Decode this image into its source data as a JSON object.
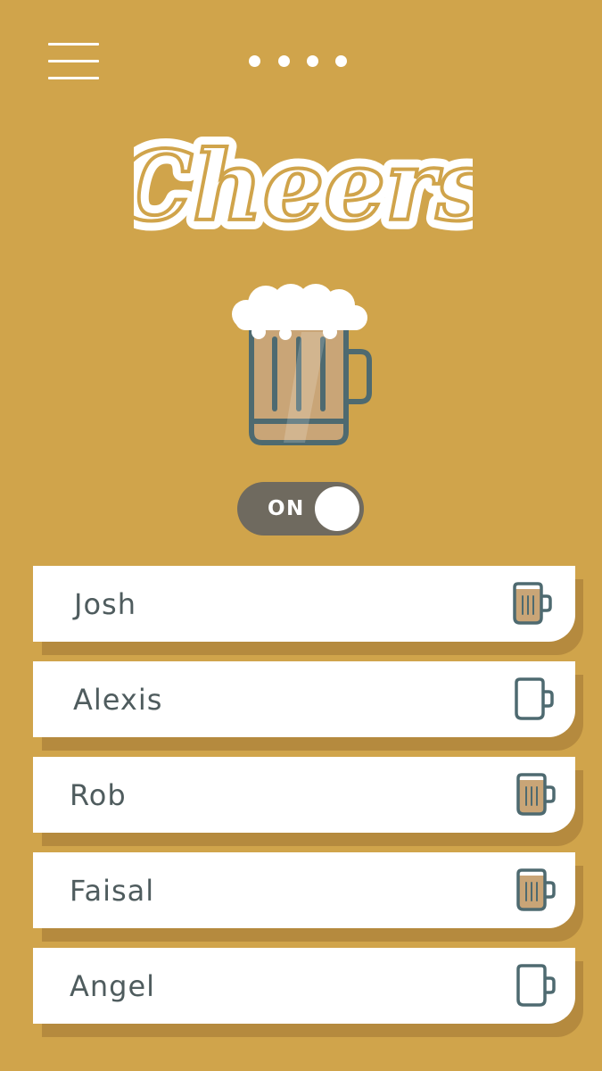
{
  "header": {
    "menu_icon": "hamburger-menu-icon",
    "page_indicator_count": 4,
    "logo_text": "Cheers"
  },
  "hero": {
    "icon": "beer-mug-icon"
  },
  "toggle": {
    "label": "ON",
    "state": true
  },
  "friends": [
    {
      "name": "Josh",
      "beer_full": true
    },
    {
      "name": "Alexis",
      "beer_full": false
    },
    {
      "name": "Rob",
      "beer_full": true
    },
    {
      "name": "Faisal",
      "beer_full": true
    },
    {
      "name": "Angel",
      "beer_full": false
    }
  ],
  "colors": {
    "background": "#D0A44B",
    "row_shadow": "#B58A3E",
    "toggle_bg": "#6F6A5F",
    "text": "#4F5C5E",
    "mug_outline": "#4E6A70",
    "beer": "#C9A577"
  }
}
